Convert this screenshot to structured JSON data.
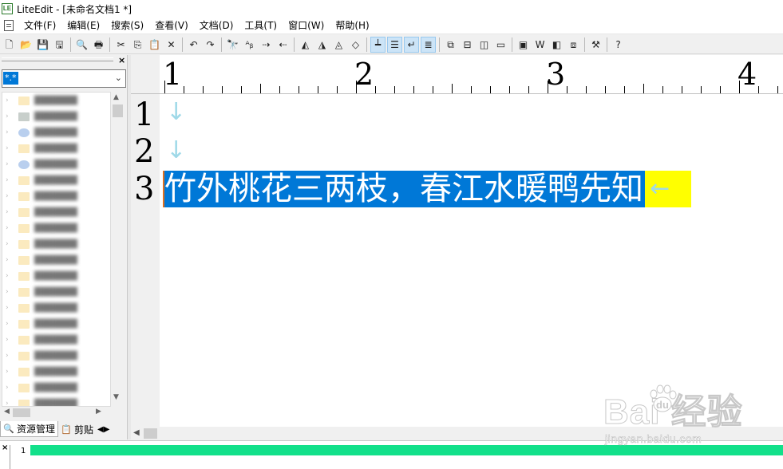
{
  "window": {
    "title": "LiteEdit - [未命名文档1 *]",
    "app_icon": "LE"
  },
  "menu": [
    "文件(F)",
    "编辑(E)",
    "搜索(S)",
    "查看(V)",
    "文档(D)",
    "工具(T)",
    "窗口(W)",
    "帮助(H)"
  ],
  "toolbar": {
    "buttons": [
      {
        "icon": "new-file-icon",
        "glyph": "🗋"
      },
      {
        "icon": "open-folder-icon",
        "glyph": "📂"
      },
      {
        "icon": "save-icon",
        "glyph": "💾"
      },
      {
        "icon": "save-all-icon",
        "glyph": "🖫"
      },
      {
        "sep": true
      },
      {
        "icon": "print-preview-icon",
        "glyph": "🔍"
      },
      {
        "icon": "print-icon",
        "glyph": "🖶"
      },
      {
        "sep": true
      },
      {
        "icon": "cut-icon",
        "glyph": "✂"
      },
      {
        "icon": "copy-icon",
        "glyph": "⎘"
      },
      {
        "icon": "paste-icon",
        "glyph": "📋"
      },
      {
        "icon": "delete-icon",
        "glyph": "✕"
      },
      {
        "sep": true
      },
      {
        "icon": "undo-icon",
        "glyph": "↶"
      },
      {
        "icon": "redo-icon",
        "glyph": "↷"
      },
      {
        "sep": true
      },
      {
        "icon": "find-icon",
        "glyph": "🔭"
      },
      {
        "icon": "find-replace-icon",
        "glyph": "ᴬᵦ"
      },
      {
        "icon": "find-next-icon",
        "glyph": "⇢"
      },
      {
        "icon": "find-prev-icon",
        "glyph": "⇠"
      },
      {
        "sep": true
      },
      {
        "icon": "bookmark-toggle-icon",
        "glyph": "◭"
      },
      {
        "icon": "bookmark-next-icon",
        "glyph": "◮"
      },
      {
        "icon": "bookmark-prev-icon",
        "glyph": "◬"
      },
      {
        "icon": "bookmark-clear-icon",
        "glyph": "◇"
      },
      {
        "sep": true
      },
      {
        "icon": "ruler-icon",
        "glyph": "┷",
        "active": true
      },
      {
        "icon": "line-numbers-icon",
        "glyph": "☰",
        "active": true
      },
      {
        "icon": "word-wrap-icon",
        "glyph": "↵",
        "active": true
      },
      {
        "icon": "show-whitespace-icon",
        "glyph": "≣",
        "active": true
      },
      {
        "sep": true
      },
      {
        "icon": "cascade-icon",
        "glyph": "⧉"
      },
      {
        "icon": "tile-horizontal-icon",
        "glyph": "⊟"
      },
      {
        "icon": "tile-vertical-icon",
        "glyph": "◫"
      },
      {
        "icon": "minimize-all-icon",
        "glyph": "▭"
      },
      {
        "sep": true
      },
      {
        "icon": "view-file-icon",
        "glyph": "▣"
      },
      {
        "icon": "word-icon",
        "glyph": "W"
      },
      {
        "icon": "layout-icon",
        "glyph": "◧"
      },
      {
        "icon": "image-view-icon",
        "glyph": "⧈"
      },
      {
        "sep": true
      },
      {
        "icon": "tools-hammer-icon",
        "glyph": "⚒"
      },
      {
        "sep": true
      },
      {
        "icon": "help-icon",
        "glyph": "?"
      }
    ]
  },
  "sidebar": {
    "filter_value": "*.*",
    "tree_rows": [
      {
        "icon": "folder"
      },
      {
        "icon": "gray"
      },
      {
        "icon": "blue"
      },
      {
        "icon": "folder"
      },
      {
        "icon": "blue"
      },
      {
        "icon": "folder"
      },
      {
        "icon": "folder"
      },
      {
        "icon": "folder"
      },
      {
        "icon": "folder"
      },
      {
        "icon": "folder"
      },
      {
        "icon": "folder"
      },
      {
        "icon": "folder"
      },
      {
        "icon": "folder"
      },
      {
        "icon": "folder"
      },
      {
        "icon": "folder"
      },
      {
        "icon": "folder"
      },
      {
        "icon": "folder"
      },
      {
        "icon": "folder"
      },
      {
        "icon": "folder"
      },
      {
        "icon": "folder"
      }
    ],
    "tabs": [
      {
        "label": "资源管理",
        "icon": "explorer-icon",
        "active": true
      },
      {
        "label": "剪贴",
        "icon": "clipboard-icon",
        "active": false
      }
    ]
  },
  "ruler": {
    "labels": [
      "1",
      "2",
      "3",
      "4"
    ]
  },
  "editor": {
    "line_numbers": [
      "1",
      "2",
      "3"
    ],
    "line1_mark": "↓",
    "line2_mark": "↓",
    "line3_text": "竹外桃花三两枝，春江水暖鸭先知",
    "line3_eol": "←"
  },
  "output": {
    "line_number": "1"
  },
  "watermark": {
    "brand": "Bai  经验",
    "url": "jingyan.baidu.com"
  },
  "colors": {
    "selection": "#0078d7",
    "eol_highlight": "#ffff00",
    "output_bar": "#12e08a",
    "whitespace_mark": "#9fd9e8"
  }
}
